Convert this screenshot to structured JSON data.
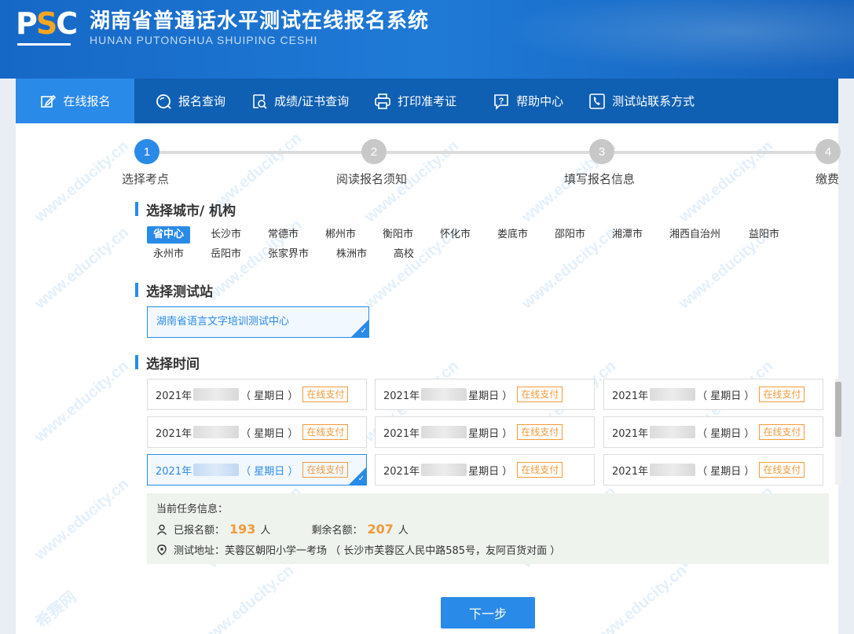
{
  "header": {
    "logo_prefix": "P",
    "logo_s": "S",
    "logo_suffix": "C",
    "title": "湖南省普通话水平测试在线报名系统",
    "subtitle": "HUNAN PUTONGHUA SHUIPING CESHI"
  },
  "nav": [
    {
      "label": "在线报名",
      "icon": "edit-icon"
    },
    {
      "label": "报名查询",
      "icon": "search-icon"
    },
    {
      "label": "成绩/证书查询",
      "icon": "certificate-search-icon"
    },
    {
      "label": "打印准考证",
      "icon": "printer-icon"
    },
    {
      "label": "帮助中心",
      "icon": "help-icon"
    },
    {
      "label": "测试站联系方式",
      "icon": "phone-icon"
    }
  ],
  "steps": [
    {
      "num": "1",
      "label": "选择考点"
    },
    {
      "num": "2",
      "label": "阅读报名须知"
    },
    {
      "num": "3",
      "label": "填写报名信息"
    },
    {
      "num": "4",
      "label": "缴费"
    }
  ],
  "sections": {
    "city": "选择城市/ 机构",
    "station": "选择测试站",
    "time": "选择时间"
  },
  "cities": [
    "省中心",
    "长沙市",
    "常德市",
    "郴州市",
    "衡阳市",
    "怀化市",
    "娄底市",
    "邵阳市",
    "湘潭市",
    "湘西自治州",
    "益阳市",
    "永州市",
    "岳阳市",
    "张家界市",
    "株洲市",
    "高校"
  ],
  "station": "湖南省语言文字培训测试中心",
  "time_cards": [
    {
      "year": "2021年",
      "weekday": "（ 星期日 ）",
      "pay": "在线支付"
    },
    {
      "year": "2021年",
      "weekday": "星期日 ）",
      "pay": "在线支付"
    },
    {
      "year": "2021年",
      "weekday": "（ 星期日 ）",
      "pay": "在线支付"
    },
    {
      "year": "2021年",
      "weekday": "（ 星期日 ）",
      "pay": "在线支付"
    },
    {
      "year": "2021年",
      "weekday": "星期日 ）",
      "pay": "在线支付"
    },
    {
      "year": "2021年",
      "weekday": "（ 星期日 ）",
      "pay": "在线支付"
    },
    {
      "year": "2021年",
      "weekday": "（ 星期日 ）",
      "pay": "在线支付"
    },
    {
      "year": "2021年",
      "weekday": "星期日 ）",
      "pay": "在线支付"
    },
    {
      "year": "2021年",
      "weekday": "（ 星期日 ）",
      "pay": "在线支付"
    }
  ],
  "task": {
    "title": "当前任务信息：",
    "registered_label": "已报名额：",
    "registered": "193",
    "remaining_label": "剩余名额：",
    "remaining": "207",
    "unit": "人",
    "address": "测试地址：芙蓉区朝阳小学一考场 （ 长沙市芙蓉区人民中路585号，友阿百货对面 ）"
  },
  "next_button": "下一步",
  "watermark": {
    "text": "www.educity.cn",
    "brand": "希赛网"
  },
  "colors": {
    "primary": "#2a8ae8",
    "nav_bg": "#0f5fb2",
    "accent": "#f39a3a"
  }
}
